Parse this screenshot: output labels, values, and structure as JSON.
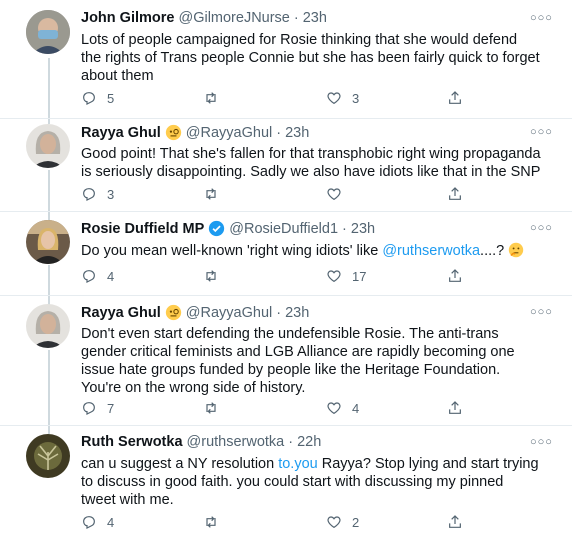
{
  "tweets": [
    {
      "name": "John Gilmore",
      "handle": "@GilmoreJNurse",
      "dot": "·",
      "time": "23h",
      "text": "Lots of people campaigned for Rosie thinking that she would defend the rights of Trans people Connie but she has been fairly quick to forget about them",
      "replies": "5",
      "retweets": "",
      "likes": "3"
    },
    {
      "name": "Rayya Ghul",
      "badge_icon": "monocle-face-emoji",
      "handle": "@RayyaGhul",
      "dot": "·",
      "time": "23h",
      "text": "Good point!  That she's fallen for that transphobic right wing propaganda is seriously disappointing.  Sadly we also have idiots like that in the SNP",
      "replies": "3",
      "retweets": "",
      "likes": ""
    },
    {
      "name": "Rosie Duffield MP",
      "badge_icon": "verified-badge",
      "handle": "@RosieDuffield1",
      "dot": "·",
      "time": "23h",
      "text_before": "Do you mean well-known 'right wing idiots' like ",
      "text_link": "@ruthserwotka",
      "text_after": "....? ",
      "emoji": "thinking-face-emoji",
      "replies": "4",
      "retweets": "",
      "likes": "17"
    },
    {
      "name": "Rayya Ghul",
      "badge_icon": "monocle-face-emoji",
      "handle": "@RayyaGhul",
      "dot": "·",
      "time": "23h",
      "text": "Don't even start defending the undefensible Rosie.  The anti-trans gender critical feminists and LGB Alliance are rapidly becoming one issue hate groups funded by people like the Heritage Foundation.  You're on the wrong side of history.",
      "replies": "7",
      "retweets": "",
      "likes": "4"
    },
    {
      "name": "Ruth Serwotka",
      "handle": "@ruthserwotka",
      "dot": "·",
      "time": "22h",
      "text_before": "can u suggest a NY resolution ",
      "text_link": "to.you",
      "text_after": " Rayya? Stop lying and start trying to discuss  in good faith. you could start with discussing my pinned tweet with me.",
      "replies": "4",
      "retweets": "",
      "likes": "2"
    }
  ],
  "colors": {
    "accent": "#1d9bf0",
    "secondary_text": "#536471",
    "thread_line": "#cfd9de",
    "divider": "#e6ecf0"
  }
}
